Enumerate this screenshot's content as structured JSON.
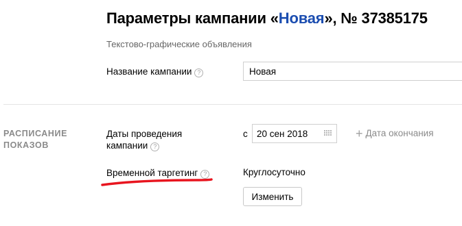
{
  "header": {
    "title_prefix": "Параметры кампании «",
    "campaign_name": "Новая",
    "title_suffix": "», № 37385175",
    "subtitle": "Текстово-графические объявления"
  },
  "campaign_name_field": {
    "label": "Название кампании",
    "help_glyph": "?",
    "value": "Новая"
  },
  "schedule_section": {
    "heading": "РАСПИСАНИЕ ПОКАЗОВ",
    "dates": {
      "label": "Даты проведения кампании",
      "help_glyph": "?",
      "from_prefix": "с",
      "start_date": "20 сен 2018",
      "add_end_date_label": "Дата окончания",
      "add_icon": "+"
    },
    "time_targeting": {
      "label": "Временной таргетинг",
      "help_glyph": "?",
      "value": "Круглосуточно",
      "change_button_label": "Изменить"
    }
  },
  "colors": {
    "campaign_name_link": "#1b4db0",
    "annotation_underline": "#e8151f",
    "muted_text": "#8a8a8a"
  },
  "icons": {
    "help": "help-question-icon",
    "calendar": "calendar-grid-icon",
    "add": "plus-icon"
  }
}
